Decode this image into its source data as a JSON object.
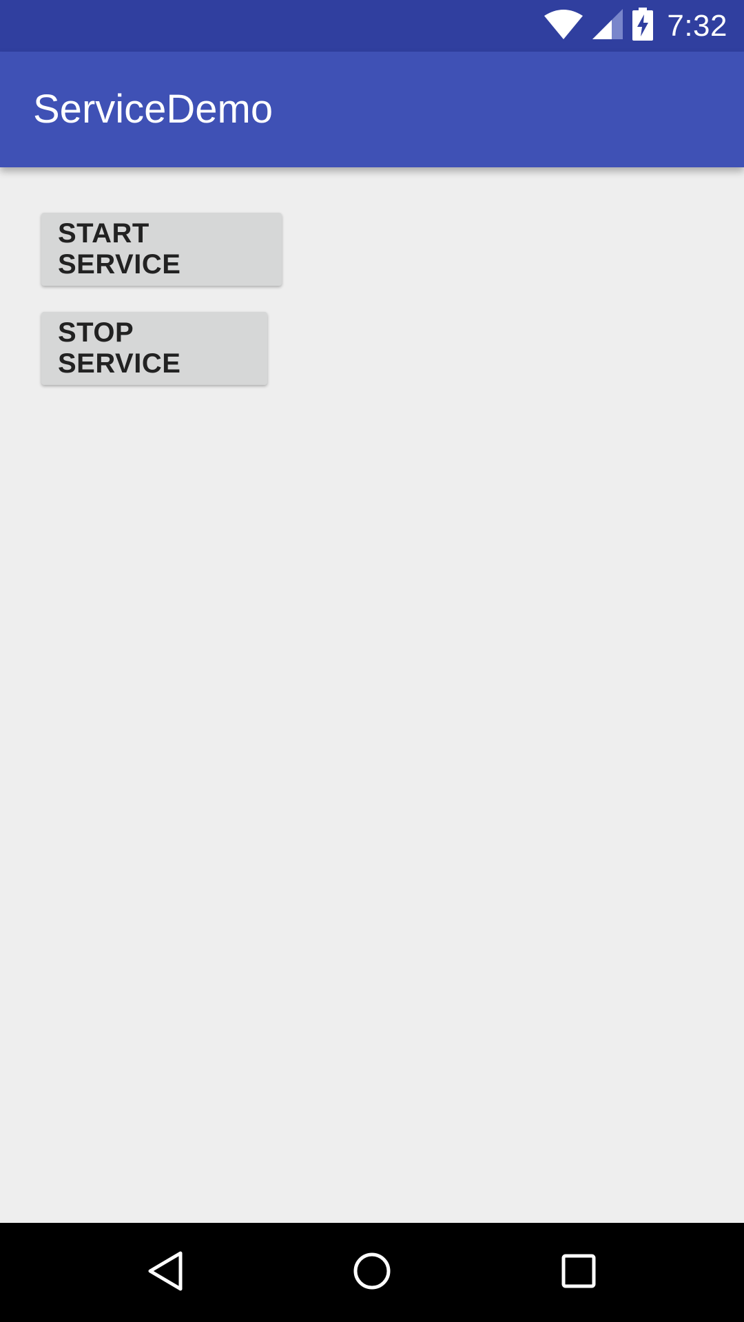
{
  "status_bar": {
    "time": "7:32",
    "icons": [
      "wifi-icon",
      "signal-icon",
      "battery-charging-icon"
    ],
    "color": "#303f9f"
  },
  "app_bar": {
    "title": "ServiceDemo",
    "color": "#3f51b5"
  },
  "main": {
    "start_button_label": "START SERVICE",
    "stop_button_label": "STOP SERVICE",
    "button_color": "#d6d7d7",
    "background": "#eeeeee"
  },
  "nav_bar": {
    "icons": [
      "back-icon",
      "home-icon",
      "recents-icon"
    ]
  }
}
